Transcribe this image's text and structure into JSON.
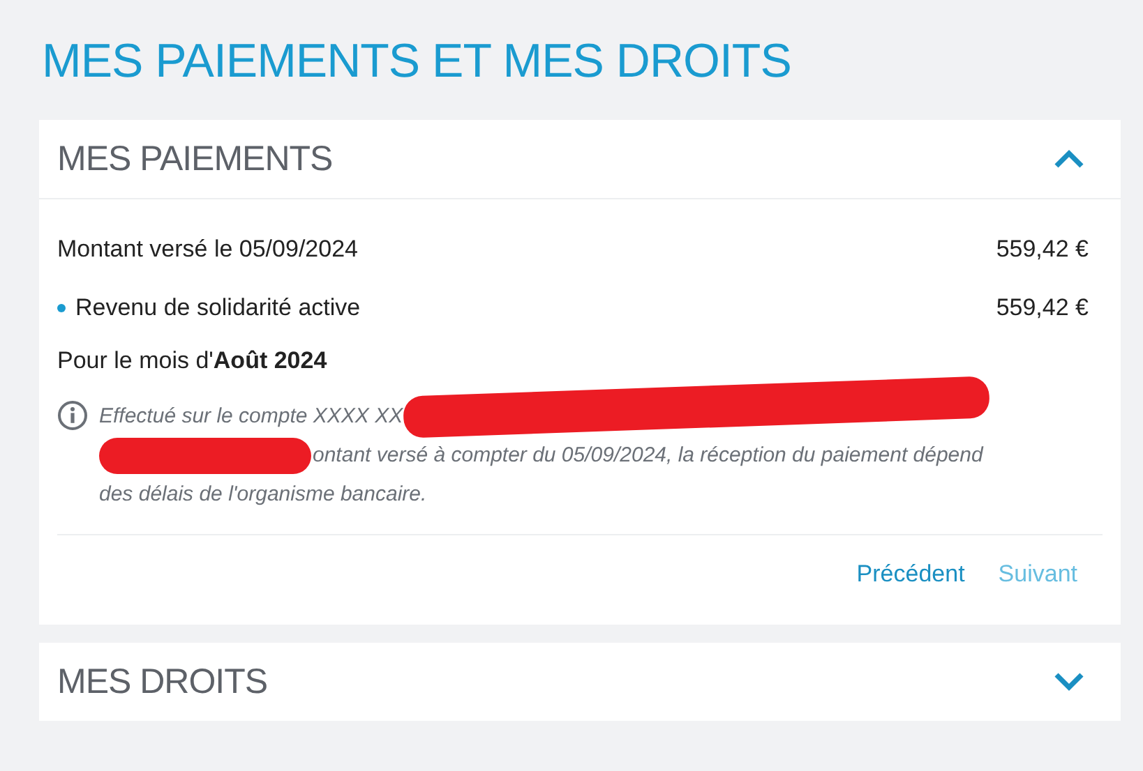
{
  "page_title": "MES PAIEMENTS ET MES DROITS",
  "sections": [
    {
      "title": "MES PAIEMENTS",
      "expanded": true,
      "rows": [
        {
          "kind": "total",
          "label": "Montant versé le 05/09/2024",
          "amount": "559,42 €"
        },
        {
          "kind": "bullet",
          "label": "Revenu de solidarité active",
          "amount": "559,42 €"
        }
      ],
      "period": "Pour le mois d'**Août 2024**",
      "note": {
        "lines": [
          {
            "text": "Effectué sur le compte XXXX XX",
            "redacted_before": false,
            "redacted_after": true
          },
          {
            "text": "ontant versé à compter du 05/09/2024, la réception du paiement dépend",
            "redacted_before": true,
            "redacted_after": false
          },
          {
            "text": "des délais de l'organisme bancaire.",
            "redacted_before": false,
            "redacted_after": false
          }
        ]
      },
      "pager": [
        {
          "label": "Précédent",
          "disabled": false
        },
        {
          "label": "Suivant",
          "disabled": true
        }
      ]
    },
    {
      "title": "MES DROITS",
      "expanded": false
    }
  ]
}
